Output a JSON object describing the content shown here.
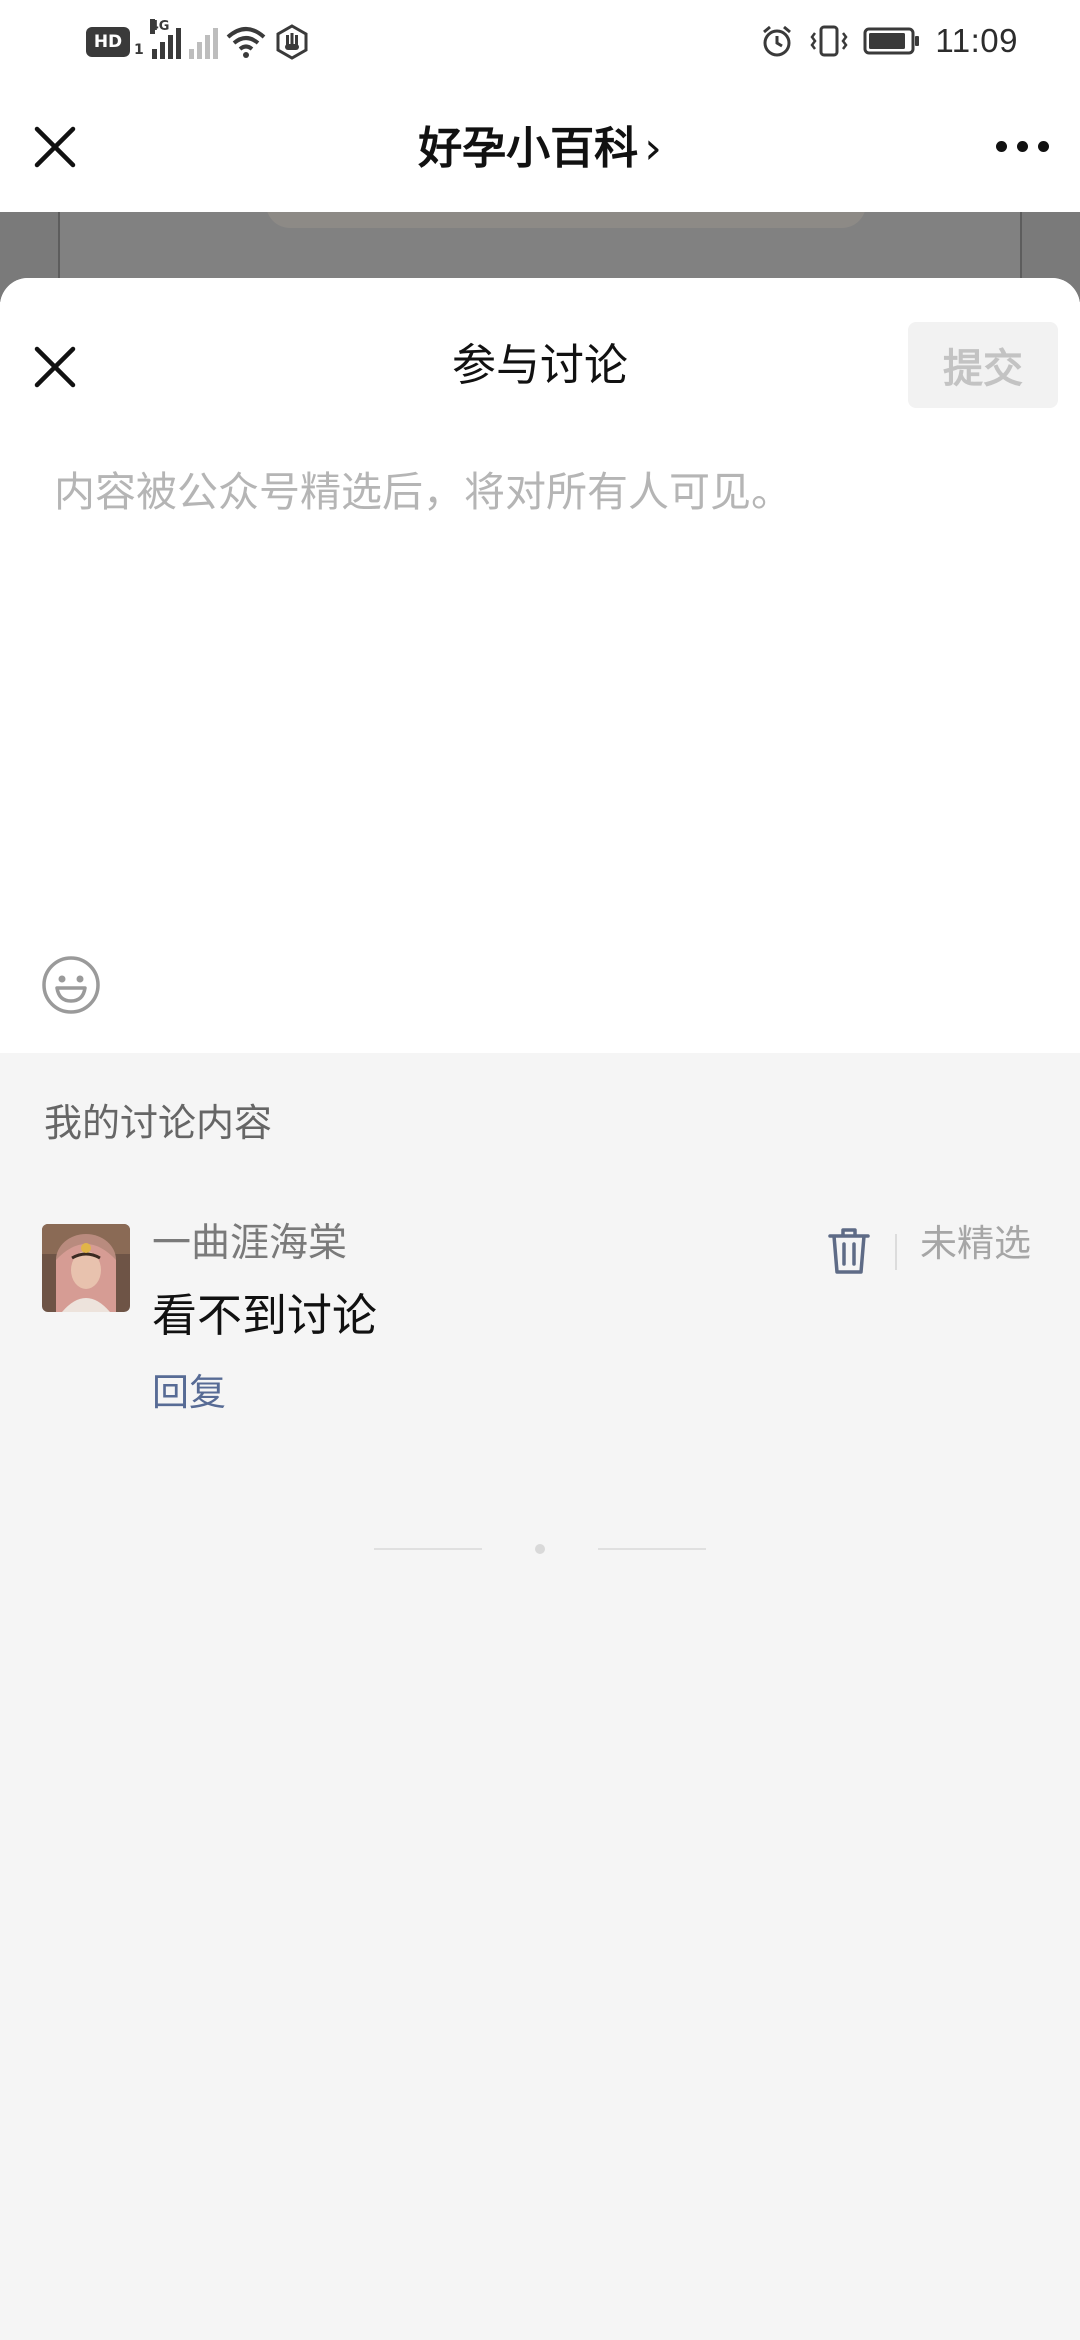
{
  "status_bar": {
    "hd_badge": "HD",
    "sim_number": "1",
    "network_type": "4G",
    "time": "11:09",
    "icons": [
      "hd-icon",
      "signal-icon",
      "no-signal-icon",
      "wifi-icon",
      "hand-icon",
      "alarm-icon",
      "vibrate-icon",
      "battery-icon"
    ]
  },
  "nav": {
    "title": "好孕小百科",
    "title_chevron": "›",
    "close_icon": "close-icon",
    "more_icon": "more-icon"
  },
  "discussion_sheet": {
    "title": "参与讨论",
    "submit_label": "提交",
    "input_placeholder": "内容被公众号精选后，将对所有人可见。",
    "input_value": "",
    "emoji_icon": "emoji-icon"
  },
  "my_discussions": {
    "section_title": "我的讨论内容",
    "comments": [
      {
        "author": "一曲涯海棠",
        "text": "看不到讨论",
        "reply_label": "回复",
        "status": "未精选",
        "delete_icon": "trash-icon"
      }
    ]
  },
  "colors": {
    "link": "#576b95",
    "placeholder": "#b5b5b5",
    "submit_disabled_bg": "#f2f2f2",
    "submit_disabled_text": "#c3c3c3",
    "page_bg": "#f5f5f5"
  }
}
